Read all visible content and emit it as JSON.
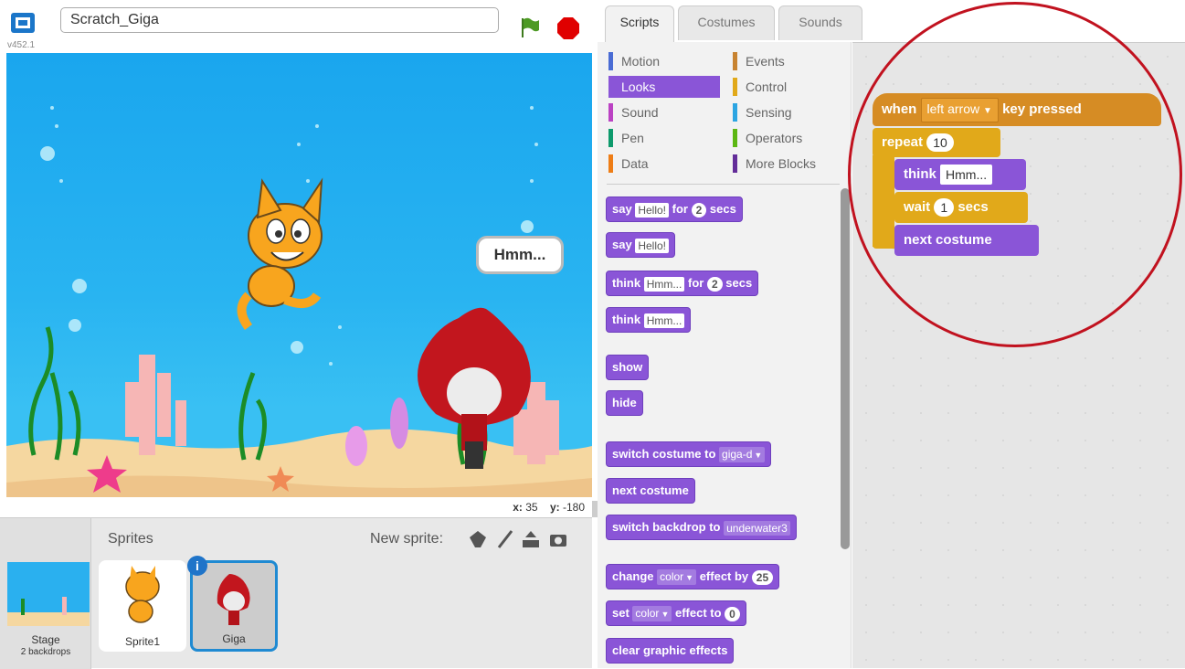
{
  "project": {
    "title": "Scratch_Giga",
    "version": "v452.1"
  },
  "stage": {
    "bubble_text": "Hmm...",
    "x_label": "x:",
    "x_value": "35",
    "y_label": "y:",
    "y_value": "-180"
  },
  "sprites_pane": {
    "title": "Sprites",
    "new_sprite_label": "New sprite:",
    "stage_name": "Stage",
    "stage_backdrops": "2 backdrops",
    "sprites": [
      "Sprite1",
      "Giga"
    ]
  },
  "tabs": [
    "Scripts",
    "Costumes",
    "Sounds"
  ],
  "categories": [
    {
      "label": "Motion",
      "color": "#4a6cd4"
    },
    {
      "label": "Looks",
      "color": "#8a55d7"
    },
    {
      "label": "Sound",
      "color": "#bb42c3"
    },
    {
      "label": "Pen",
      "color": "#0e9a6c"
    },
    {
      "label": "Data",
      "color": "#ee7d16"
    },
    {
      "label": "Events",
      "color": "#c88330"
    },
    {
      "label": "Control",
      "color": "#e1a91a"
    },
    {
      "label": "Sensing",
      "color": "#2ca5e2"
    },
    {
      "label": "Operators",
      "color": "#5cb712"
    },
    {
      "label": "More Blocks",
      "color": "#632d99"
    }
  ],
  "palette_blocks": {
    "say_for": {
      "a": "say",
      "slot": "Hello!",
      "b": "for",
      "num": "2",
      "c": "secs"
    },
    "say": {
      "a": "say",
      "slot": "Hello!"
    },
    "think_for": {
      "a": "think",
      "slot": "Hmm...",
      "b": "for",
      "num": "2",
      "c": "secs"
    },
    "think": {
      "a": "think",
      "slot": "Hmm..."
    },
    "show": "show",
    "hide": "hide",
    "switch_costume": {
      "a": "switch costume to",
      "drop": "giga-d"
    },
    "next_costume": "next costume",
    "switch_backdrop": {
      "a": "switch backdrop to",
      "drop": "underwater3"
    },
    "change_effect": {
      "a": "change",
      "drop": "color",
      "b": "effect by",
      "num": "25"
    },
    "set_effect": {
      "a": "set",
      "drop": "color",
      "b": "effect to",
      "num": "0"
    },
    "clear_effects": "clear graphic effects"
  },
  "script": {
    "hat": {
      "a": "when",
      "key": "left arrow",
      "b": "key pressed"
    },
    "repeat": {
      "a": "repeat",
      "num": "10"
    },
    "think": {
      "a": "think",
      "slot": "Hmm..."
    },
    "wait": {
      "a": "wait",
      "num": "1",
      "b": "secs"
    },
    "next_costume": "next costume"
  },
  "colors": {
    "looks": "#8a55d7",
    "events": "#d68c24",
    "control": "#e1a91a",
    "highlight": "#c1121f"
  }
}
